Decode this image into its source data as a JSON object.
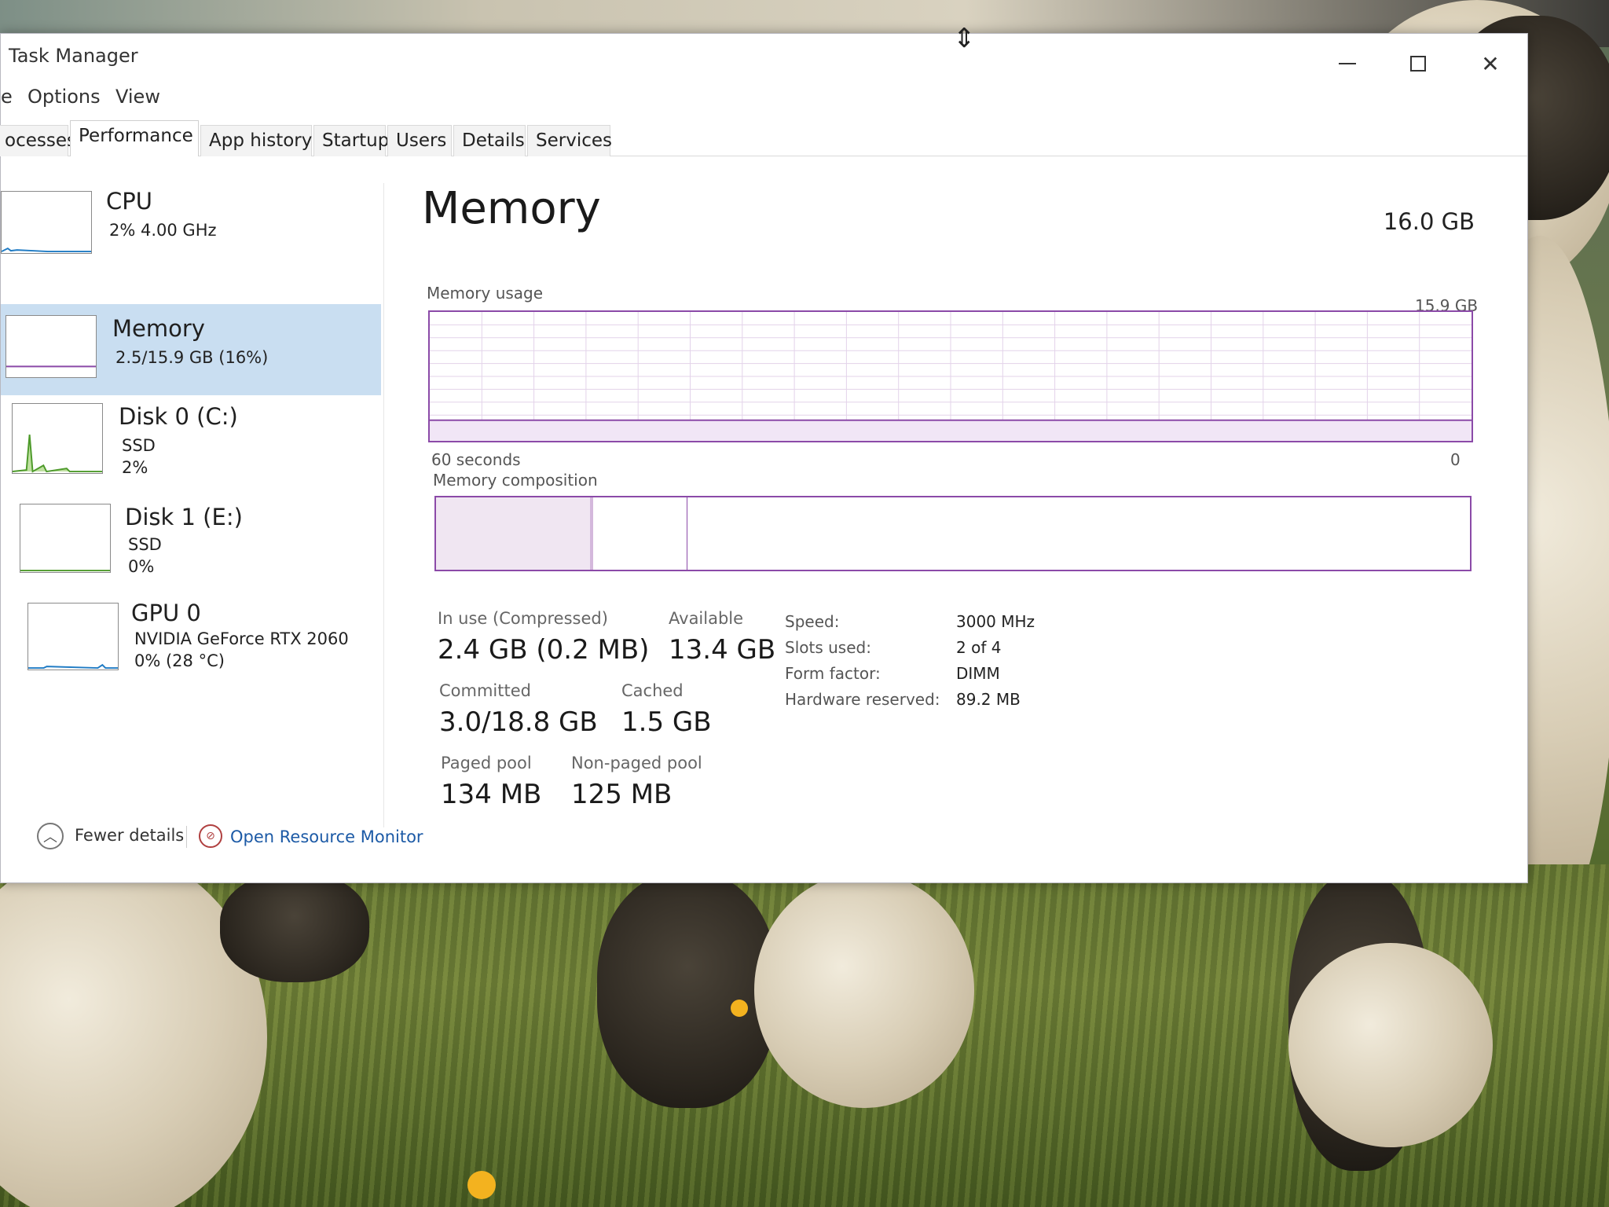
{
  "window": {
    "title": "Task Manager"
  },
  "menu": {
    "file": "e",
    "options": "Options",
    "view": "View"
  },
  "tabs": [
    {
      "label": "ocesses"
    },
    {
      "label": "Performance",
      "active": true
    },
    {
      "label": "App history"
    },
    {
      "label": "Startup"
    },
    {
      "label": "Users"
    },
    {
      "label": "Details"
    },
    {
      "label": "Services"
    }
  ],
  "sidebar": {
    "items": [
      {
        "title": "CPU",
        "line1": "2%  4.00 GHz",
        "line2": ""
      },
      {
        "title": "Memory",
        "line1": "2.5/15.9 GB (16%)",
        "line2": "",
        "selected": true
      },
      {
        "title": "Disk 0 (C:)",
        "line1": "SSD",
        "line2": "2%"
      },
      {
        "title": "Disk 1 (E:)",
        "line1": "SSD",
        "line2": "0%"
      },
      {
        "title": "GPU 0",
        "line1": "NVIDIA GeForce RTX 2060",
        "line2": "0%  (28 °C)"
      }
    ]
  },
  "main": {
    "title": "Memory",
    "total": "16.0 GB",
    "usage_label": "Memory usage",
    "usage_max": "15.9 GB",
    "time_label": "60 seconds",
    "time_end": "0",
    "composition_label": "Memory composition",
    "stats": {
      "in_use_label": "In use (Compressed)",
      "in_use_value": "2.4 GB (0.2 MB)",
      "available_label": "Available",
      "available_value": "13.4 GB",
      "committed_label": "Committed",
      "committed_value": "3.0/18.8 GB",
      "cached_label": "Cached",
      "cached_value": "1.5 GB",
      "paged_label": "Paged pool",
      "paged_value": "134 MB",
      "nonpaged_label": "Non-paged pool",
      "nonpaged_value": "125 MB"
    },
    "details": {
      "speed_label": "Speed:",
      "speed_value": "3000 MHz",
      "slots_label": "Slots used:",
      "slots_value": "2 of 4",
      "form_label": "Form factor:",
      "form_value": "DIMM",
      "hw_label": "Hardware reserved:",
      "hw_value": "89.2 MB"
    },
    "usage_fraction": 0.16
  },
  "footer": {
    "fewer_details": "Fewer details",
    "open_monitor": "Open Resource Monitor"
  },
  "colors": {
    "memory_accent": "#8b4aa8",
    "selection": "#c9def1",
    "link": "#1c5aa6"
  }
}
